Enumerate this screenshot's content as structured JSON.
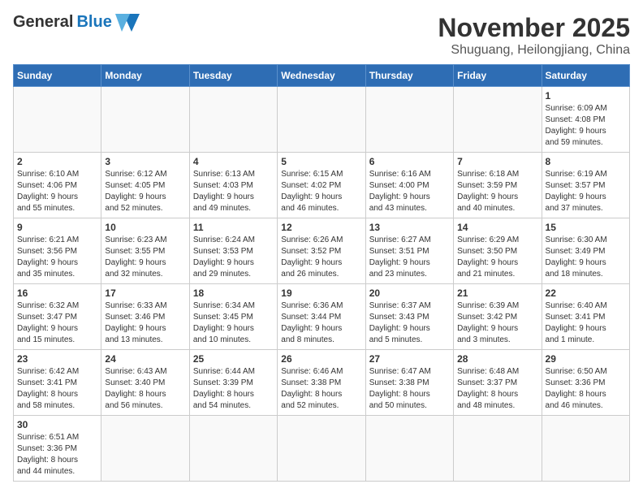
{
  "header": {
    "logo_general": "General",
    "logo_blue": "Blue",
    "month": "November 2025",
    "location": "Shuguang, Heilongjiang, China"
  },
  "days_of_week": [
    "Sunday",
    "Monday",
    "Tuesday",
    "Wednesday",
    "Thursday",
    "Friday",
    "Saturday"
  ],
  "weeks": [
    [
      {
        "day": "",
        "info": ""
      },
      {
        "day": "",
        "info": ""
      },
      {
        "day": "",
        "info": ""
      },
      {
        "day": "",
        "info": ""
      },
      {
        "day": "",
        "info": ""
      },
      {
        "day": "",
        "info": ""
      },
      {
        "day": "1",
        "info": "Sunrise: 6:09 AM\nSunset: 4:08 PM\nDaylight: 9 hours\nand 59 minutes."
      }
    ],
    [
      {
        "day": "2",
        "info": "Sunrise: 6:10 AM\nSunset: 4:06 PM\nDaylight: 9 hours\nand 55 minutes."
      },
      {
        "day": "3",
        "info": "Sunrise: 6:12 AM\nSunset: 4:05 PM\nDaylight: 9 hours\nand 52 minutes."
      },
      {
        "day": "4",
        "info": "Sunrise: 6:13 AM\nSunset: 4:03 PM\nDaylight: 9 hours\nand 49 minutes."
      },
      {
        "day": "5",
        "info": "Sunrise: 6:15 AM\nSunset: 4:02 PM\nDaylight: 9 hours\nand 46 minutes."
      },
      {
        "day": "6",
        "info": "Sunrise: 6:16 AM\nSunset: 4:00 PM\nDaylight: 9 hours\nand 43 minutes."
      },
      {
        "day": "7",
        "info": "Sunrise: 6:18 AM\nSunset: 3:59 PM\nDaylight: 9 hours\nand 40 minutes."
      },
      {
        "day": "8",
        "info": "Sunrise: 6:19 AM\nSunset: 3:57 PM\nDaylight: 9 hours\nand 37 minutes."
      }
    ],
    [
      {
        "day": "9",
        "info": "Sunrise: 6:21 AM\nSunset: 3:56 PM\nDaylight: 9 hours\nand 35 minutes."
      },
      {
        "day": "10",
        "info": "Sunrise: 6:23 AM\nSunset: 3:55 PM\nDaylight: 9 hours\nand 32 minutes."
      },
      {
        "day": "11",
        "info": "Sunrise: 6:24 AM\nSunset: 3:53 PM\nDaylight: 9 hours\nand 29 minutes."
      },
      {
        "day": "12",
        "info": "Sunrise: 6:26 AM\nSunset: 3:52 PM\nDaylight: 9 hours\nand 26 minutes."
      },
      {
        "day": "13",
        "info": "Sunrise: 6:27 AM\nSunset: 3:51 PM\nDaylight: 9 hours\nand 23 minutes."
      },
      {
        "day": "14",
        "info": "Sunrise: 6:29 AM\nSunset: 3:50 PM\nDaylight: 9 hours\nand 21 minutes."
      },
      {
        "day": "15",
        "info": "Sunrise: 6:30 AM\nSunset: 3:49 PM\nDaylight: 9 hours\nand 18 minutes."
      }
    ],
    [
      {
        "day": "16",
        "info": "Sunrise: 6:32 AM\nSunset: 3:47 PM\nDaylight: 9 hours\nand 15 minutes."
      },
      {
        "day": "17",
        "info": "Sunrise: 6:33 AM\nSunset: 3:46 PM\nDaylight: 9 hours\nand 13 minutes."
      },
      {
        "day": "18",
        "info": "Sunrise: 6:34 AM\nSunset: 3:45 PM\nDaylight: 9 hours\nand 10 minutes."
      },
      {
        "day": "19",
        "info": "Sunrise: 6:36 AM\nSunset: 3:44 PM\nDaylight: 9 hours\nand 8 minutes."
      },
      {
        "day": "20",
        "info": "Sunrise: 6:37 AM\nSunset: 3:43 PM\nDaylight: 9 hours\nand 5 minutes."
      },
      {
        "day": "21",
        "info": "Sunrise: 6:39 AM\nSunset: 3:42 PM\nDaylight: 9 hours\nand 3 minutes."
      },
      {
        "day": "22",
        "info": "Sunrise: 6:40 AM\nSunset: 3:41 PM\nDaylight: 9 hours\nand 1 minute."
      }
    ],
    [
      {
        "day": "23",
        "info": "Sunrise: 6:42 AM\nSunset: 3:41 PM\nDaylight: 8 hours\nand 58 minutes."
      },
      {
        "day": "24",
        "info": "Sunrise: 6:43 AM\nSunset: 3:40 PM\nDaylight: 8 hours\nand 56 minutes."
      },
      {
        "day": "25",
        "info": "Sunrise: 6:44 AM\nSunset: 3:39 PM\nDaylight: 8 hours\nand 54 minutes."
      },
      {
        "day": "26",
        "info": "Sunrise: 6:46 AM\nSunset: 3:38 PM\nDaylight: 8 hours\nand 52 minutes."
      },
      {
        "day": "27",
        "info": "Sunrise: 6:47 AM\nSunset: 3:38 PM\nDaylight: 8 hours\nand 50 minutes."
      },
      {
        "day": "28",
        "info": "Sunrise: 6:48 AM\nSunset: 3:37 PM\nDaylight: 8 hours\nand 48 minutes."
      },
      {
        "day": "29",
        "info": "Sunrise: 6:50 AM\nSunset: 3:36 PM\nDaylight: 8 hours\nand 46 minutes."
      }
    ],
    [
      {
        "day": "30",
        "info": "Sunrise: 6:51 AM\nSunset: 3:36 PM\nDaylight: 8 hours\nand 44 minutes."
      },
      {
        "day": "",
        "info": ""
      },
      {
        "day": "",
        "info": ""
      },
      {
        "day": "",
        "info": ""
      },
      {
        "day": "",
        "info": ""
      },
      {
        "day": "",
        "info": ""
      },
      {
        "day": "",
        "info": ""
      }
    ]
  ]
}
